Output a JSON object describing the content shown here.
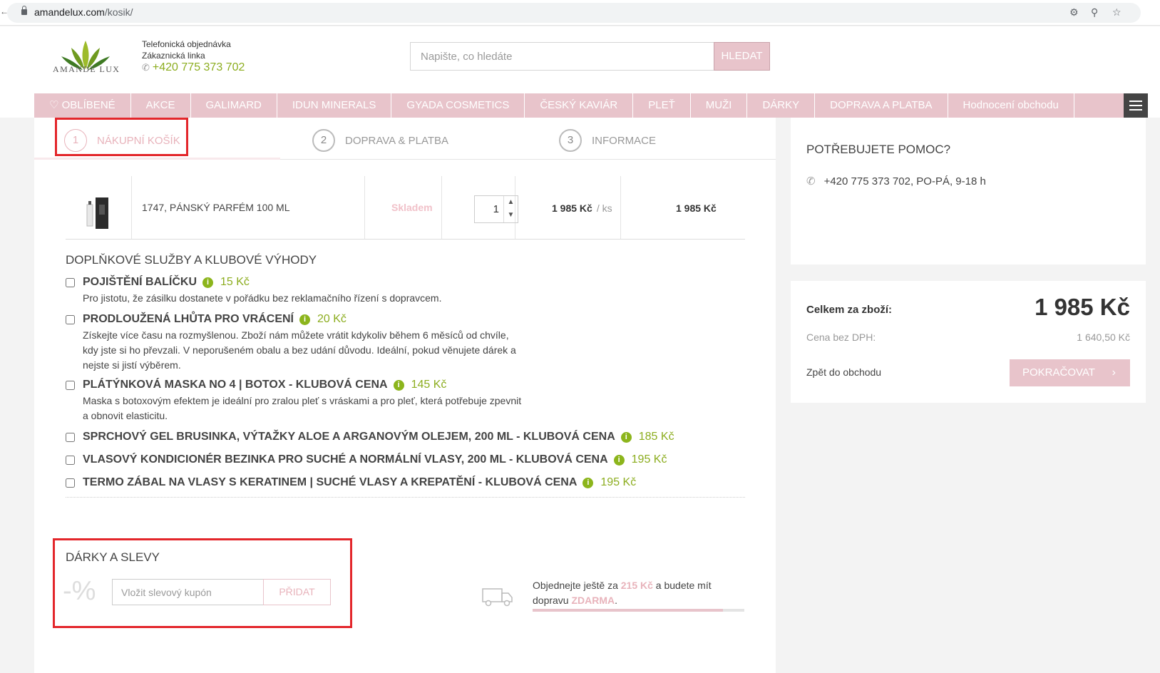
{
  "browser": {
    "domain": "amandelux.com",
    "path": "/kosik/"
  },
  "header": {
    "logo_text": "AMANDE LUX",
    "contact_line1": "Telefonická objednávka",
    "contact_line2": "Zákaznická linka",
    "contact_phone": "+420 775 373 702",
    "search_placeholder": "Napište, co hledáte",
    "search_button": "HLEDAT"
  },
  "nav": {
    "items": [
      "OBLÍBENÉ",
      "AKCE",
      "GALIMARD",
      "IDUN MINERALS",
      "GYADA COSMETICS",
      "ČESKÝ KAVIÁR",
      "PLEŤ",
      "MUŽI",
      "DÁRKY",
      "DOPRAVA A PLATBA",
      "Hodnocení obchodu"
    ]
  },
  "steps": [
    {
      "num": "1",
      "label": "NÁKUPNÍ KOŠÍK"
    },
    {
      "num": "2",
      "label": "DOPRAVA & PLATBA"
    },
    {
      "num": "3",
      "label": "INFORMACE"
    }
  ],
  "cart": {
    "product_name": "1747, PÁNSKÝ PARFÉM 100 ML",
    "availability": "Skladem",
    "quantity": "1",
    "unit_price": "1 985 Kč",
    "unit_suffix": "/ ks",
    "total_price": "1 985 Kč"
  },
  "services": {
    "title": "DOPLŇKOVÉ SLUŽBY A KLUBOVÉ VÝHODY",
    "items": [
      {
        "name": "POJIŠTĚNÍ BALÍČKU",
        "price": "15 Kč",
        "desc": "Pro jistotu, že zásilku dostanete v pořádku bez reklamačního řízení s dopravcem."
      },
      {
        "name": "PRODLOUŽENÁ LHŮTA PRO VRÁCENÍ",
        "price": "20 Kč",
        "desc": "Získejte více času na rozmyšlenou. Zboží nám můžete vrátit kdykoliv během 6 měsíců od chvíle, kdy jste si ho převzali. V neporušeném obalu a bez udání důvodu. Ideální, pokud věnujete dárek a nejste si jistí výběrem."
      },
      {
        "name": "PLÁTÝNKOVÁ MASKA NO 4 | BOTOX - KLUBOVÁ CENA",
        "price": "145 Kč",
        "desc": "Maska s botoxovým efektem je ideální pro zralou pleť s vráskami a pro pleť, která potřebuje zpevnit a obnovit elasticitu."
      },
      {
        "name": "SPRCHOVÝ GEL BRUSINKA, VÝTAŽKY ALOE A ARGANOVÝM OLEJEM, 200 ML - KLUBOVÁ CENA",
        "price": "185 Kč",
        "desc": ""
      },
      {
        "name": "VLASOVÝ KONDICIONÉR BEZINKA PRO SUCHÉ A NORMÁLNÍ VLASY, 200 ML - KLUBOVÁ CENA",
        "price": "195 Kč",
        "desc": ""
      },
      {
        "name": "TERMO ZÁBAL NA VLASY S KERATINEM | SUCHÉ VLASY A KREPATĚNÍ - KLUBOVÁ CENA",
        "price": "195 Kč",
        "desc": ""
      }
    ]
  },
  "gifts": {
    "title": "DÁRKY A SLEVY",
    "percent_symbol": "-%",
    "coupon_placeholder": "Vložit slevový kupón",
    "add_button": "PŘIDAT"
  },
  "shipping": {
    "text_before": "Objednejte ještě za",
    "amount": "215 Kč",
    "text_middle": "a budete mít dopravu",
    "free": "ZDARMA",
    "text_end": ".",
    "progress_fraction": 0.9
  },
  "help": {
    "title": "POTŘEBUJETE POMOC?",
    "phone": "+420 775 373 702, PO-PÁ, 9-18 h"
  },
  "summary": {
    "total_label": "Celkem za zboží:",
    "total_value": "1 985 Kč",
    "net_label": "Cena bez DPH:",
    "net_value": "1 640,50 Kč",
    "back_link": "Zpět do obchodu",
    "continue_button": "POKRAČOVAT"
  },
  "colors": {
    "brand_pink": "#e8c4cb",
    "accent_green": "#8cad1f",
    "highlight_red": "#e3262b"
  }
}
